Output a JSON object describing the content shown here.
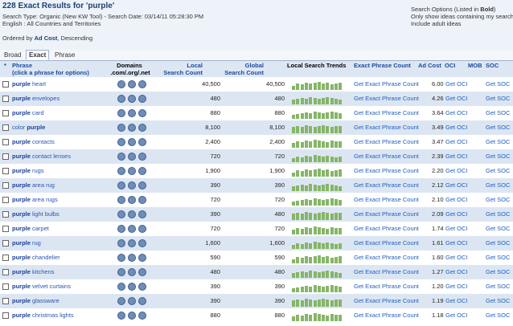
{
  "header": {
    "title": "228 Exact Results for 'purple'",
    "line1": "Search Type: Organic (New KW Tool) - Search Date: 03/14/11 05:28:30 PM",
    "line2": "English : All Countries and Territories",
    "ordered_prefix": "Ordered by ",
    "ordered_field": "Ad Cost",
    "ordered_suffix": ", Descending"
  },
  "options": {
    "title": "Search Options (Listed in ",
    "title_bold": "Bold",
    "title_end": ")",
    "line1": "Only show ideas containing my search te",
    "line2": "Include adult ideas"
  },
  "tabs": [
    {
      "label": "Broad",
      "active": false
    },
    {
      "label": "Exact",
      "active": true
    },
    {
      "label": "Phrase",
      "active": false
    }
  ],
  "columns": {
    "star": "*",
    "phrase_1": "Phrase",
    "phrase_2": "(click a phrase for options)",
    "domains_1": "Domains",
    "domains_2": ".com/.org/.net",
    "local_1": "Local",
    "local_2": "Search Count",
    "global_1": "Global",
    "global_2": "Search Count",
    "trends": "Local Search Trends",
    "epc": "Exact Phrase Count",
    "ad_cost": "Ad Cost",
    "oci": "OCI",
    "mob": "MOB",
    "soc": "SOC"
  },
  "link_texts": {
    "epc": "Get Exact Phrase Count",
    "oci": "Get OCI",
    "soc": "Get SOC"
  },
  "colors": {
    "accent": "#1f5fbf",
    "alt_row": "#dce6f3",
    "trend_bar": "#86b567"
  },
  "rows": [
    {
      "pre": "",
      "bold": "purple",
      "post": " heart",
      "local": "40,500",
      "global": "40,500",
      "cost": "6.00"
    },
    {
      "pre": "",
      "bold": "purple",
      "post": " envelopes",
      "local": "480",
      "global": "480",
      "cost": "4.26"
    },
    {
      "pre": "",
      "bold": "purple",
      "post": " card",
      "local": "880",
      "global": "880",
      "cost": "3.64"
    },
    {
      "pre": "color ",
      "bold": "purple",
      "post": "",
      "local": "8,100",
      "global": "8,100",
      "cost": "3.49"
    },
    {
      "pre": "",
      "bold": "purple",
      "post": " contacts",
      "local": "2,400",
      "global": "2,400",
      "cost": "3.47"
    },
    {
      "pre": "",
      "bold": "purple",
      "post": " contact lenses",
      "local": "720",
      "global": "720",
      "cost": "2.39"
    },
    {
      "pre": "",
      "bold": "purple",
      "post": " rugs",
      "local": "1,900",
      "global": "1,900",
      "cost": "2.20"
    },
    {
      "pre": "",
      "bold": "purple",
      "post": " area rug",
      "local": "390",
      "global": "390",
      "cost": "2.12"
    },
    {
      "pre": "",
      "bold": "purple",
      "post": " area rugs",
      "local": "720",
      "global": "720",
      "cost": "2.10"
    },
    {
      "pre": "",
      "bold": "purple",
      "post": " light bulbs",
      "local": "390",
      "global": "480",
      "cost": "2.09"
    },
    {
      "pre": "",
      "bold": "purple",
      "post": " carpet",
      "local": "720",
      "global": "720",
      "cost": "1.74"
    },
    {
      "pre": "",
      "bold": "purple",
      "post": " rug",
      "local": "1,600",
      "global": "1,600",
      "cost": "1.61"
    },
    {
      "pre": "",
      "bold": "purple",
      "post": " chandelier",
      "local": "590",
      "global": "590",
      "cost": "1.60"
    },
    {
      "pre": "",
      "bold": "purple",
      "post": " kitchens",
      "local": "480",
      "global": "480",
      "cost": "1.27"
    },
    {
      "pre": "",
      "bold": "purple",
      "post": " velvet curtains",
      "local": "390",
      "global": "390",
      "cost": "1.20"
    },
    {
      "pre": "",
      "bold": "purple",
      "post": " glassware",
      "local": "390",
      "global": "390",
      "cost": "1.19"
    },
    {
      "pre": "",
      "bold": "purple",
      "post": " christmas lights",
      "local": "880",
      "global": "880",
      "cost": "1.18"
    }
  ]
}
